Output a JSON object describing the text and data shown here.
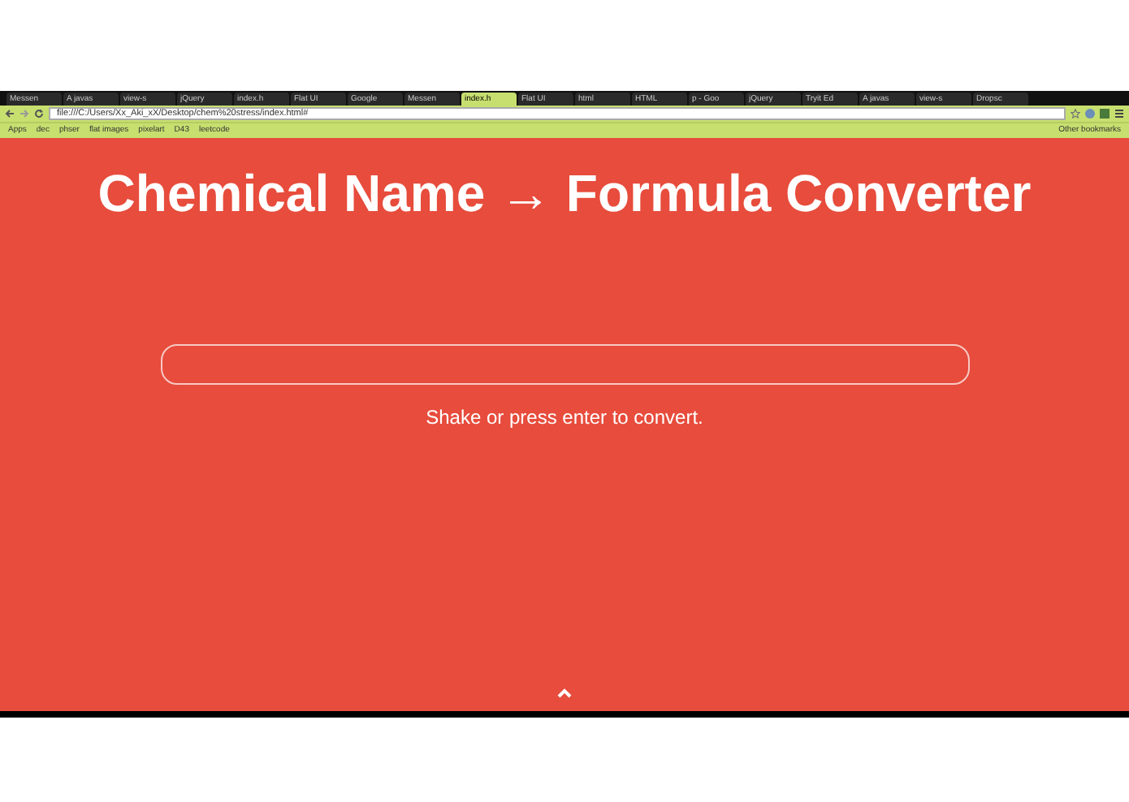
{
  "browser": {
    "tabs": [
      {
        "title": "Messen",
        "selected": false
      },
      {
        "title": "A javas",
        "selected": false
      },
      {
        "title": "view-s",
        "selected": false
      },
      {
        "title": "jQuery",
        "selected": false
      },
      {
        "title": "index.h",
        "selected": false
      },
      {
        "title": "Flat UI",
        "selected": false
      },
      {
        "title": "Google",
        "selected": false
      },
      {
        "title": "Messen",
        "selected": false
      },
      {
        "title": "index.h",
        "selected": true
      },
      {
        "title": "Flat UI",
        "selected": false
      },
      {
        "title": "html",
        "selected": false
      },
      {
        "title": "HTML",
        "selected": false
      },
      {
        "title": "p - Goo",
        "selected": false
      },
      {
        "title": "jQuery",
        "selected": false
      },
      {
        "title": "Tryit Ed",
        "selected": false
      },
      {
        "title": "A javas",
        "selected": false
      },
      {
        "title": "view-s",
        "selected": false
      },
      {
        "title": "Dropsc",
        "selected": false
      }
    ],
    "url": "file:///C:/Users/Xx_Aki_xX/Desktop/chem%20stress/index.html#",
    "bookmarks": [
      "Apps",
      "dec",
      "phser",
      "flat images",
      "pixelart",
      "D43",
      "leetcode"
    ],
    "other_bookmarks": "Other bookmarks"
  },
  "page": {
    "title": "Chemical Name → Formula Converter",
    "hint": "Shake or press enter to convert."
  }
}
